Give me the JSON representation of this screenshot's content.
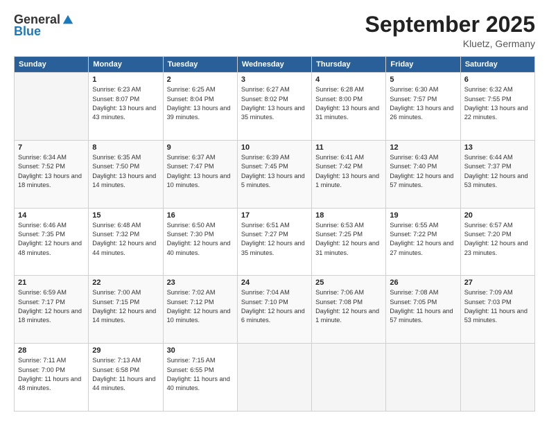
{
  "header": {
    "logo_general": "General",
    "logo_blue": "Blue",
    "month_title": "September 2025",
    "location": "Kluetz, Germany"
  },
  "weekdays": [
    "Sunday",
    "Monday",
    "Tuesday",
    "Wednesday",
    "Thursday",
    "Friday",
    "Saturday"
  ],
  "weeks": [
    [
      {
        "day": "",
        "sunrise": "",
        "sunset": "",
        "daylight": "",
        "empty": true
      },
      {
        "day": "1",
        "sunrise": "Sunrise: 6:23 AM",
        "sunset": "Sunset: 8:07 PM",
        "daylight": "Daylight: 13 hours and 43 minutes."
      },
      {
        "day": "2",
        "sunrise": "Sunrise: 6:25 AM",
        "sunset": "Sunset: 8:04 PM",
        "daylight": "Daylight: 13 hours and 39 minutes."
      },
      {
        "day": "3",
        "sunrise": "Sunrise: 6:27 AM",
        "sunset": "Sunset: 8:02 PM",
        "daylight": "Daylight: 13 hours and 35 minutes."
      },
      {
        "day": "4",
        "sunrise": "Sunrise: 6:28 AM",
        "sunset": "Sunset: 8:00 PM",
        "daylight": "Daylight: 13 hours and 31 minutes."
      },
      {
        "day": "5",
        "sunrise": "Sunrise: 6:30 AM",
        "sunset": "Sunset: 7:57 PM",
        "daylight": "Daylight: 13 hours and 26 minutes."
      },
      {
        "day": "6",
        "sunrise": "Sunrise: 6:32 AM",
        "sunset": "Sunset: 7:55 PM",
        "daylight": "Daylight: 13 hours and 22 minutes."
      }
    ],
    [
      {
        "day": "7",
        "sunrise": "Sunrise: 6:34 AM",
        "sunset": "Sunset: 7:52 PM",
        "daylight": "Daylight: 13 hours and 18 minutes."
      },
      {
        "day": "8",
        "sunrise": "Sunrise: 6:35 AM",
        "sunset": "Sunset: 7:50 PM",
        "daylight": "Daylight: 13 hours and 14 minutes."
      },
      {
        "day": "9",
        "sunrise": "Sunrise: 6:37 AM",
        "sunset": "Sunset: 7:47 PM",
        "daylight": "Daylight: 13 hours and 10 minutes."
      },
      {
        "day": "10",
        "sunrise": "Sunrise: 6:39 AM",
        "sunset": "Sunset: 7:45 PM",
        "daylight": "Daylight: 13 hours and 5 minutes."
      },
      {
        "day": "11",
        "sunrise": "Sunrise: 6:41 AM",
        "sunset": "Sunset: 7:42 PM",
        "daylight": "Daylight: 13 hours and 1 minute."
      },
      {
        "day": "12",
        "sunrise": "Sunrise: 6:43 AM",
        "sunset": "Sunset: 7:40 PM",
        "daylight": "Daylight: 12 hours and 57 minutes."
      },
      {
        "day": "13",
        "sunrise": "Sunrise: 6:44 AM",
        "sunset": "Sunset: 7:37 PM",
        "daylight": "Daylight: 12 hours and 53 minutes."
      }
    ],
    [
      {
        "day": "14",
        "sunrise": "Sunrise: 6:46 AM",
        "sunset": "Sunset: 7:35 PM",
        "daylight": "Daylight: 12 hours and 48 minutes."
      },
      {
        "day": "15",
        "sunrise": "Sunrise: 6:48 AM",
        "sunset": "Sunset: 7:32 PM",
        "daylight": "Daylight: 12 hours and 44 minutes."
      },
      {
        "day": "16",
        "sunrise": "Sunrise: 6:50 AM",
        "sunset": "Sunset: 7:30 PM",
        "daylight": "Daylight: 12 hours and 40 minutes."
      },
      {
        "day": "17",
        "sunrise": "Sunrise: 6:51 AM",
        "sunset": "Sunset: 7:27 PM",
        "daylight": "Daylight: 12 hours and 35 minutes."
      },
      {
        "day": "18",
        "sunrise": "Sunrise: 6:53 AM",
        "sunset": "Sunset: 7:25 PM",
        "daylight": "Daylight: 12 hours and 31 minutes."
      },
      {
        "day": "19",
        "sunrise": "Sunrise: 6:55 AM",
        "sunset": "Sunset: 7:22 PM",
        "daylight": "Daylight: 12 hours and 27 minutes."
      },
      {
        "day": "20",
        "sunrise": "Sunrise: 6:57 AM",
        "sunset": "Sunset: 7:20 PM",
        "daylight": "Daylight: 12 hours and 23 minutes."
      }
    ],
    [
      {
        "day": "21",
        "sunrise": "Sunrise: 6:59 AM",
        "sunset": "Sunset: 7:17 PM",
        "daylight": "Daylight: 12 hours and 18 minutes."
      },
      {
        "day": "22",
        "sunrise": "Sunrise: 7:00 AM",
        "sunset": "Sunset: 7:15 PM",
        "daylight": "Daylight: 12 hours and 14 minutes."
      },
      {
        "day": "23",
        "sunrise": "Sunrise: 7:02 AM",
        "sunset": "Sunset: 7:12 PM",
        "daylight": "Daylight: 12 hours and 10 minutes."
      },
      {
        "day": "24",
        "sunrise": "Sunrise: 7:04 AM",
        "sunset": "Sunset: 7:10 PM",
        "daylight": "Daylight: 12 hours and 6 minutes."
      },
      {
        "day": "25",
        "sunrise": "Sunrise: 7:06 AM",
        "sunset": "Sunset: 7:08 PM",
        "daylight": "Daylight: 12 hours and 1 minute."
      },
      {
        "day": "26",
        "sunrise": "Sunrise: 7:08 AM",
        "sunset": "Sunset: 7:05 PM",
        "daylight": "Daylight: 11 hours and 57 minutes."
      },
      {
        "day": "27",
        "sunrise": "Sunrise: 7:09 AM",
        "sunset": "Sunset: 7:03 PM",
        "daylight": "Daylight: 11 hours and 53 minutes."
      }
    ],
    [
      {
        "day": "28",
        "sunrise": "Sunrise: 7:11 AM",
        "sunset": "Sunset: 7:00 PM",
        "daylight": "Daylight: 11 hours and 48 minutes."
      },
      {
        "day": "29",
        "sunrise": "Sunrise: 7:13 AM",
        "sunset": "Sunset: 6:58 PM",
        "daylight": "Daylight: 11 hours and 44 minutes."
      },
      {
        "day": "30",
        "sunrise": "Sunrise: 7:15 AM",
        "sunset": "Sunset: 6:55 PM",
        "daylight": "Daylight: 11 hours and 40 minutes."
      },
      {
        "day": "",
        "sunrise": "",
        "sunset": "",
        "daylight": "",
        "empty": true
      },
      {
        "day": "",
        "sunrise": "",
        "sunset": "",
        "daylight": "",
        "empty": true
      },
      {
        "day": "",
        "sunrise": "",
        "sunset": "",
        "daylight": "",
        "empty": true
      },
      {
        "day": "",
        "sunrise": "",
        "sunset": "",
        "daylight": "",
        "empty": true
      }
    ]
  ]
}
